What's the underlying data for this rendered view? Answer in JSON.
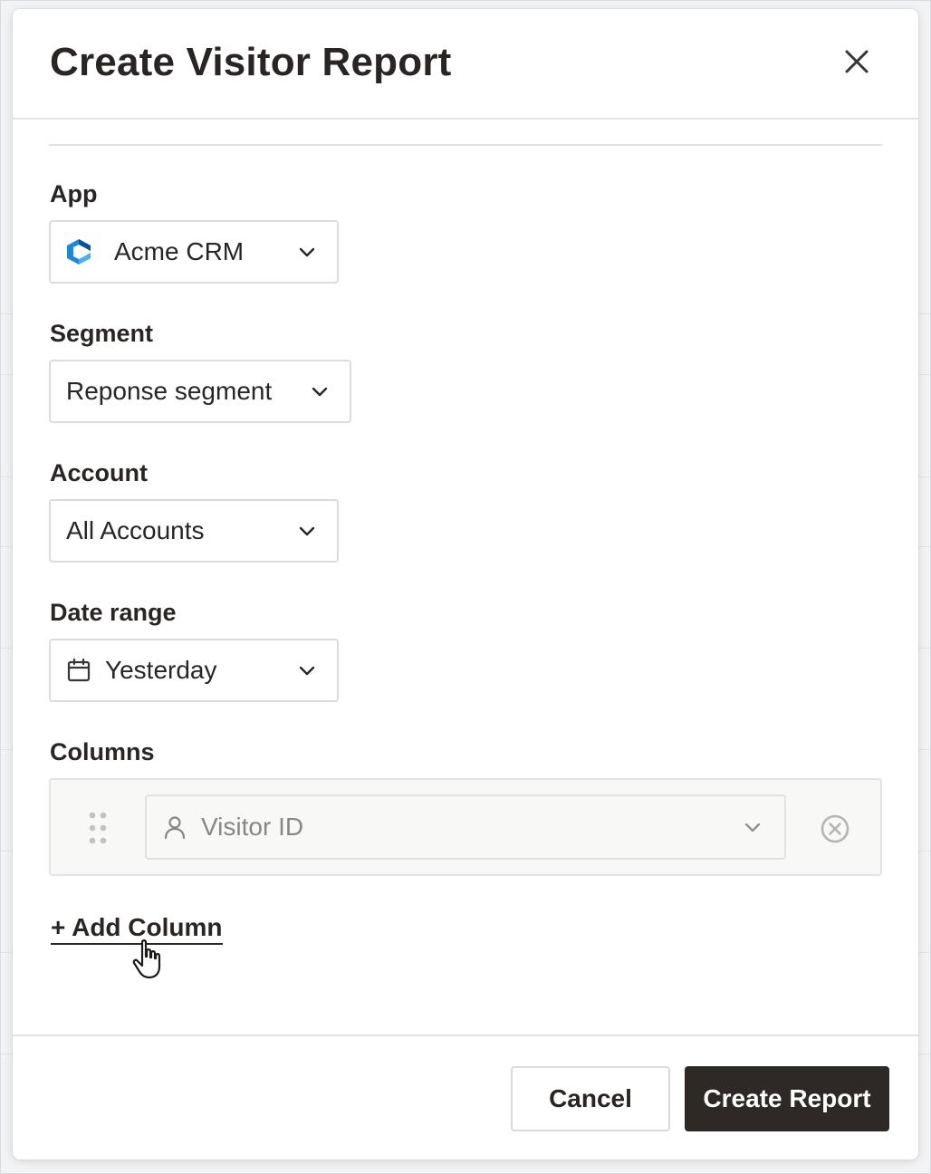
{
  "modal": {
    "title": "Create Visitor Report"
  },
  "fields": {
    "app": {
      "label": "App",
      "value": "Acme CRM",
      "icon": "app-logo-icon"
    },
    "segment": {
      "label": "Segment",
      "value": "Reponse segment"
    },
    "account": {
      "label": "Account",
      "value": "All Accounts"
    },
    "date_range": {
      "label": "Date range",
      "value": "Yesterday",
      "icon": "calendar-icon"
    }
  },
  "columns": {
    "label": "Columns",
    "items": [
      {
        "value": "Visitor ID",
        "icon": "user-icon"
      }
    ],
    "add_label": "+ Add Column"
  },
  "footer": {
    "cancel_label": "Cancel",
    "create_label": "Create Report"
  },
  "colors": {
    "primary_button": "#2e2926",
    "app_logo_blue": "#1e88d6",
    "app_logo_dark": "#0d4f9c"
  }
}
